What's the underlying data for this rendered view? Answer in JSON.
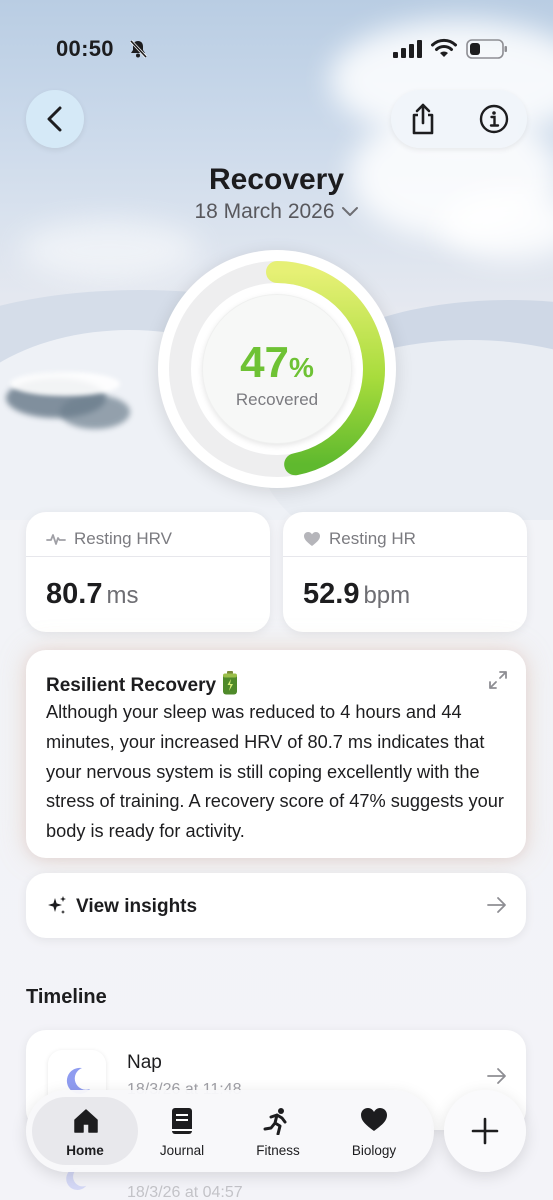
{
  "status_bar": {
    "time": "00:50"
  },
  "header": {
    "title": "Recovery",
    "date": "18 March 2026"
  },
  "recovery": {
    "percent_value": "47",
    "percent_symbol": "%",
    "label": "Recovered",
    "progress": 0.47,
    "ring_color": "#7cc83a"
  },
  "stats": {
    "hrv": {
      "label": "Resting HRV",
      "value": "80.7",
      "unit": "ms"
    },
    "hr": {
      "label": "Resting HR",
      "value": "52.9",
      "unit": "bpm"
    }
  },
  "summary": {
    "title": "Resilient Recovery",
    "body": "Although your sleep was reduced to 4 hours and 44 minutes, your increased HRV of 80.7 ms indicates that your nervous system is still coping excellently with the stress of training. A recovery score of 47% suggests your body is ready for activity."
  },
  "insights": {
    "label": "View insights"
  },
  "timeline": {
    "heading": "Timeline",
    "items": [
      {
        "title": "Nap",
        "subtitle": "18/3/26 at 11:48",
        "icon": "moon-icon"
      },
      {
        "title": "",
        "subtitle": "18/3/26 at 04:57",
        "icon": "moon-icon"
      }
    ]
  },
  "tabbar": {
    "tabs": [
      {
        "label": "Home",
        "icon": "home-icon",
        "active": true
      },
      {
        "label": "Journal",
        "icon": "book-icon",
        "active": false
      },
      {
        "label": "Fitness",
        "icon": "runner-icon",
        "active": false
      },
      {
        "label": "Biology",
        "icon": "heart-icon",
        "active": false
      }
    ]
  },
  "colors": {
    "accent_green": "#6ec234",
    "back_button_bg": "#d6eaf7"
  }
}
